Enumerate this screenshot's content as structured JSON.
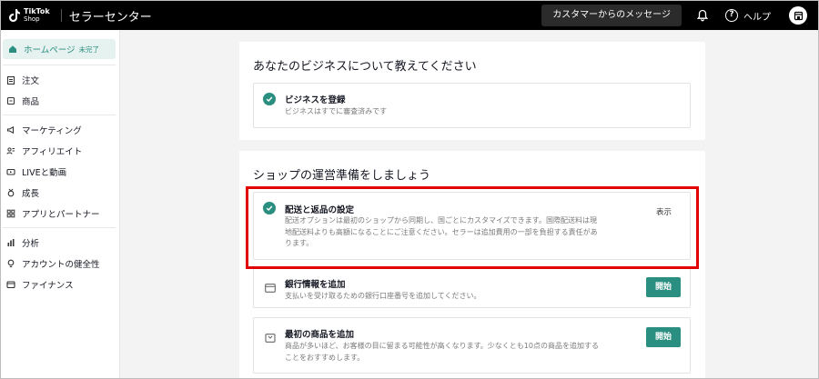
{
  "header": {
    "logo_line1": "TikTok",
    "logo_line2": "Shop",
    "app_title": "セラーセンター",
    "messages_button": "カスタマーからのメッセージ",
    "help_label": "ヘルプ"
  },
  "sidebar": {
    "home": {
      "label": "ホームページ",
      "badge": "未完了"
    },
    "items": [
      {
        "label": "注文"
      },
      {
        "label": "商品"
      },
      {
        "label": "マーケティング"
      },
      {
        "label": "アフィリエイト"
      },
      {
        "label": "LIVEと動画"
      },
      {
        "label": "成長"
      },
      {
        "label": "アプリとパートナー"
      },
      {
        "label": "分析"
      },
      {
        "label": "アカウントの健全性"
      },
      {
        "label": "ファイナンス"
      }
    ]
  },
  "main": {
    "business_card": {
      "title": "あなたのビジネスについて教えてください",
      "task": {
        "title": "ビジネスを登録",
        "desc": "ビジネスはすでに審査済みです"
      }
    },
    "shop_card": {
      "title": "ショップの運営準備をしましょう",
      "shipping": {
        "title": "配送と返品の設定",
        "desc_line1": "配送オプションは最初のショップから同期し、国ごとにカスタマイズできます。国際配送料は現",
        "desc_line2": "地配送料よりも高額になることにご注意ください。セラーは追加費用の一部を負担する責任があ",
        "desc_line3": "ります。",
        "action": "表示"
      },
      "bank": {
        "title": "銀行情報を追加",
        "desc": "支払いを受け取るための銀行口座番号を追加してください。",
        "action": "開始"
      },
      "product": {
        "title": "最初の商品を追加",
        "desc_line1": "商品が多いほど、お客様の目に留まる可能性が高くなります。少なくとも10点の商品を追加する",
        "desc_line2": "ことをおすすめします。",
        "action": "開始"
      }
    }
  },
  "colors": {
    "accent": "#2a8f80",
    "highlight": "#e00000",
    "topbar": "#000000"
  }
}
